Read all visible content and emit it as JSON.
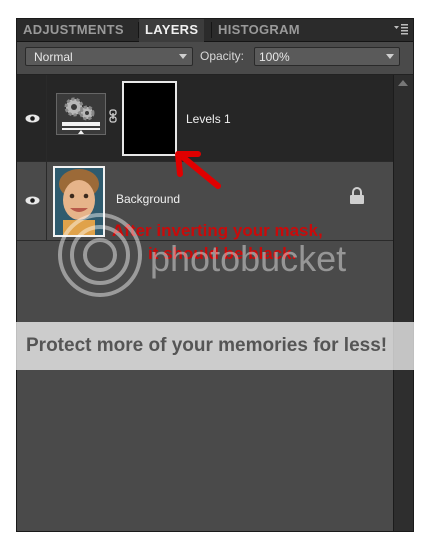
{
  "tabs": [
    {
      "label": "ADJUSTMENTS",
      "active": false
    },
    {
      "label": "LAYERS",
      "active": true
    },
    {
      "label": "HISTOGRAM",
      "active": false
    }
  ],
  "blend_mode": {
    "value": "Normal"
  },
  "opacity": {
    "label": "Opacity:",
    "value": "100%"
  },
  "layers": [
    {
      "name": "Levels 1",
      "type": "adjustment",
      "selected": true,
      "visible": true,
      "mask_color": "#000000"
    },
    {
      "name": "Background",
      "type": "image",
      "selected": false,
      "visible": true,
      "locked": true
    }
  ],
  "annotation": {
    "line1": "After inverting your mask,",
    "line2": "it should be black.",
    "color": "#e00000"
  },
  "watermark": {
    "brand": "photobucket",
    "banner": "Protect more of your memories for less!"
  },
  "icons": [
    "eye-icon",
    "lock-icon",
    "chain-link-icon",
    "gears-icon",
    "panel-menu-icon",
    "dropdown-arrow-icon"
  ]
}
